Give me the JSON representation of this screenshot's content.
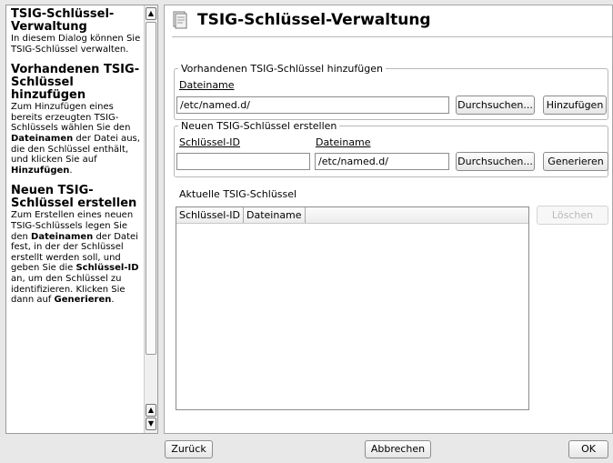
{
  "help": {
    "s1_title": "TSIG-Schlüssel-Verwaltung",
    "s1_text": "In diesem Dialog können Sie TSIG-Schlüssel verwalten.",
    "s2_title": "Vorhandenen TSIG-Schlüssel hinzufügen",
    "s2_a": "Zum Hinzufügen eines bereits erzeugten TSIG-Schlüssels wählen Sie den ",
    "s2_b": "Dateinamen",
    "s2_c": " der Datei aus, die den Schlüssel enthält, und klicken Sie auf ",
    "s2_d": "Hinzufügen",
    "s2_e": ".",
    "s3_title": "Neuen TSIG-Schlüssel erstellen",
    "s3_a": "Zum Erstellen eines neuen TSIG-Schlüssels legen Sie den ",
    "s3_b": "Dateinamen",
    "s3_c": " der Datei fest, in der der Schlüssel erstellt werden soll, und geben Sie die ",
    "s3_d": "Schlüssel-ID",
    "s3_e": " an, um den Schlüssel zu identifizieren. Klicken Sie dann auf ",
    "s3_f": "Generieren",
    "s3_g": "."
  },
  "main": {
    "title": "TSIG-Schlüssel-Verwaltung",
    "add_group": {
      "legend": "Vorhandenen TSIG-Schlüssel hinzufügen",
      "filename_label": "Dateiname",
      "filename_value": "/etc/named.d/",
      "browse_label": "Durchsuchen...",
      "add_label": "Hinzufügen"
    },
    "create_group": {
      "legend": "Neuen TSIG-Schlüssel erstellen",
      "keyid_label": "Schlüssel-ID",
      "keyid_value": "",
      "filename_label": "Dateiname",
      "filename_value": "/etc/named.d/",
      "browse_label": "Durchsuchen...",
      "generate_label": "Generieren"
    },
    "current_label": "Aktuelle TSIG-Schlüssel",
    "table": {
      "columns": [
        "Schlüssel-ID",
        "Dateiname"
      ],
      "rows": []
    },
    "delete_label": "Löschen"
  },
  "footer": {
    "back_label": "Zurück",
    "cancel_label": "Abbrechen",
    "ok_label": "OK"
  }
}
